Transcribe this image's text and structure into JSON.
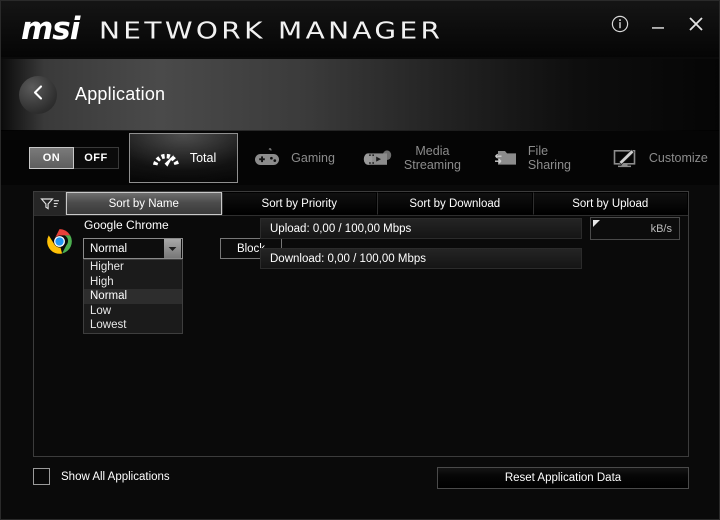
{
  "window": {
    "brand": "msi",
    "app_title": "NETWORK MANAGER",
    "controls": {
      "info": "info-icon",
      "minimize": "minimize-icon",
      "close": "close-icon"
    }
  },
  "header": {
    "back_icon": "chevron-left-icon",
    "title": "Application"
  },
  "toggle": {
    "on_label": "ON",
    "off_label": "OFF",
    "selected": "ON"
  },
  "tabs": [
    {
      "label": "Total",
      "icon": "gauge-icon",
      "active": true
    },
    {
      "label": "Gaming",
      "icon": "gamepad-icon",
      "active": false
    },
    {
      "label_line1": "Media",
      "label_line2": "Streaming",
      "icon": "film-reel-icon",
      "active": false
    },
    {
      "label": "File Sharing",
      "icon": "folder-transfer-icon",
      "active": false
    },
    {
      "label": "Customize",
      "icon": "monitor-pencil-icon",
      "active": false
    }
  ],
  "sortbar": {
    "filter_icon": "filter-funnel-icon",
    "buttons": [
      {
        "label": "Sort by Name",
        "active": true
      },
      {
        "label": "Sort by Priority",
        "active": false
      },
      {
        "label": "Sort by Download",
        "active": false
      },
      {
        "label": "Sort by Upload",
        "active": false
      }
    ]
  },
  "application_row": {
    "icon": "chrome-icon",
    "name": "Google Chrome",
    "priority": {
      "value": "Normal",
      "arrow_icon": "chevron-down-icon",
      "open": true,
      "options": [
        "Higher",
        "High",
        "Normal",
        "Low",
        "Lowest"
      ],
      "selected_index": 2
    },
    "block_label": "Block",
    "upload": "Upload: 0,00 / 100,00 Mbps",
    "download": "Download: 0,00 / 100,00 Mbps",
    "speed_unit": "kB/s",
    "speed_value": ""
  },
  "footer": {
    "show_all_label": "Show All Applications",
    "show_all_checked": false,
    "reset_label": "Reset Application Data"
  },
  "colors": {
    "background": "#0a0a0a",
    "accent_border": "#c9c9c9",
    "text": "#ffffff",
    "muted_text": "#8c8c8c"
  }
}
